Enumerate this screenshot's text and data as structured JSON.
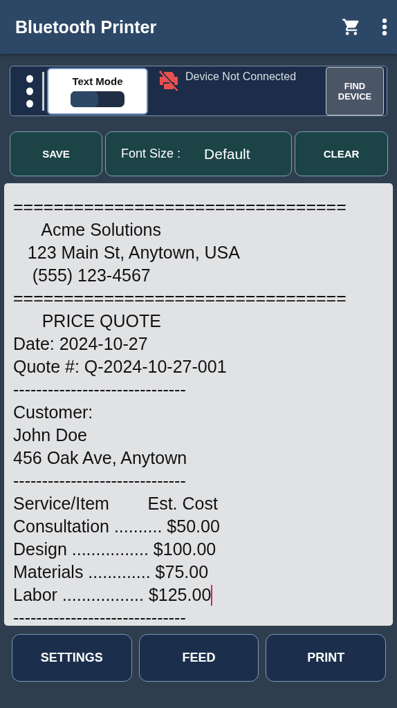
{
  "app_bar": {
    "title": "Bluetooth Printer"
  },
  "toolbar": {
    "mode_label": "Text Mode",
    "mode_on": false,
    "status": "Device Not Connected",
    "find_button": "FIND\nDEVICE"
  },
  "actions": {
    "save": "SAVE",
    "font_size_label": "Font Size :",
    "font_size_value": "Default",
    "clear": "CLEAR"
  },
  "editor": {
    "lines": [
      {
        "text": "=================================",
        "cursor": false
      },
      {
        "text": "      Acme Solutions",
        "cursor": false
      },
      {
        "text": "   123 Main St, Anytown, USA",
        "cursor": false
      },
      {
        "text": "    (555) 123-4567",
        "cursor": false
      },
      {
        "text": "=================================",
        "cursor": false
      },
      {
        "text": "      PRICE QUOTE",
        "cursor": false
      },
      {
        "text": "Date: 2024-10-27",
        "cursor": false
      },
      {
        "text": "Quote #: Q-2024-10-27-001",
        "cursor": false
      },
      {
        "text": "------------------------------",
        "cursor": false
      },
      {
        "text": "Customer:",
        "cursor": false
      },
      {
        "text": "John Doe",
        "cursor": false
      },
      {
        "text": "456 Oak Ave, Anytown",
        "cursor": false
      },
      {
        "text": "------------------------------",
        "cursor": false
      },
      {
        "text": "Service/Item        Est. Cost",
        "cursor": false
      },
      {
        "text": "Consultation .......... $50.00",
        "cursor": false
      },
      {
        "text": "Design ................ $100.00",
        "cursor": false
      },
      {
        "text": "Materials ............. $75.00",
        "cursor": false
      },
      {
        "text": "Labor ................. $125.00",
        "cursor": true
      },
      {
        "text": "------------------------------",
        "cursor": false
      }
    ]
  },
  "bottom_buttons": [
    "SETTINGS",
    "FEED",
    "PRINT"
  ]
}
